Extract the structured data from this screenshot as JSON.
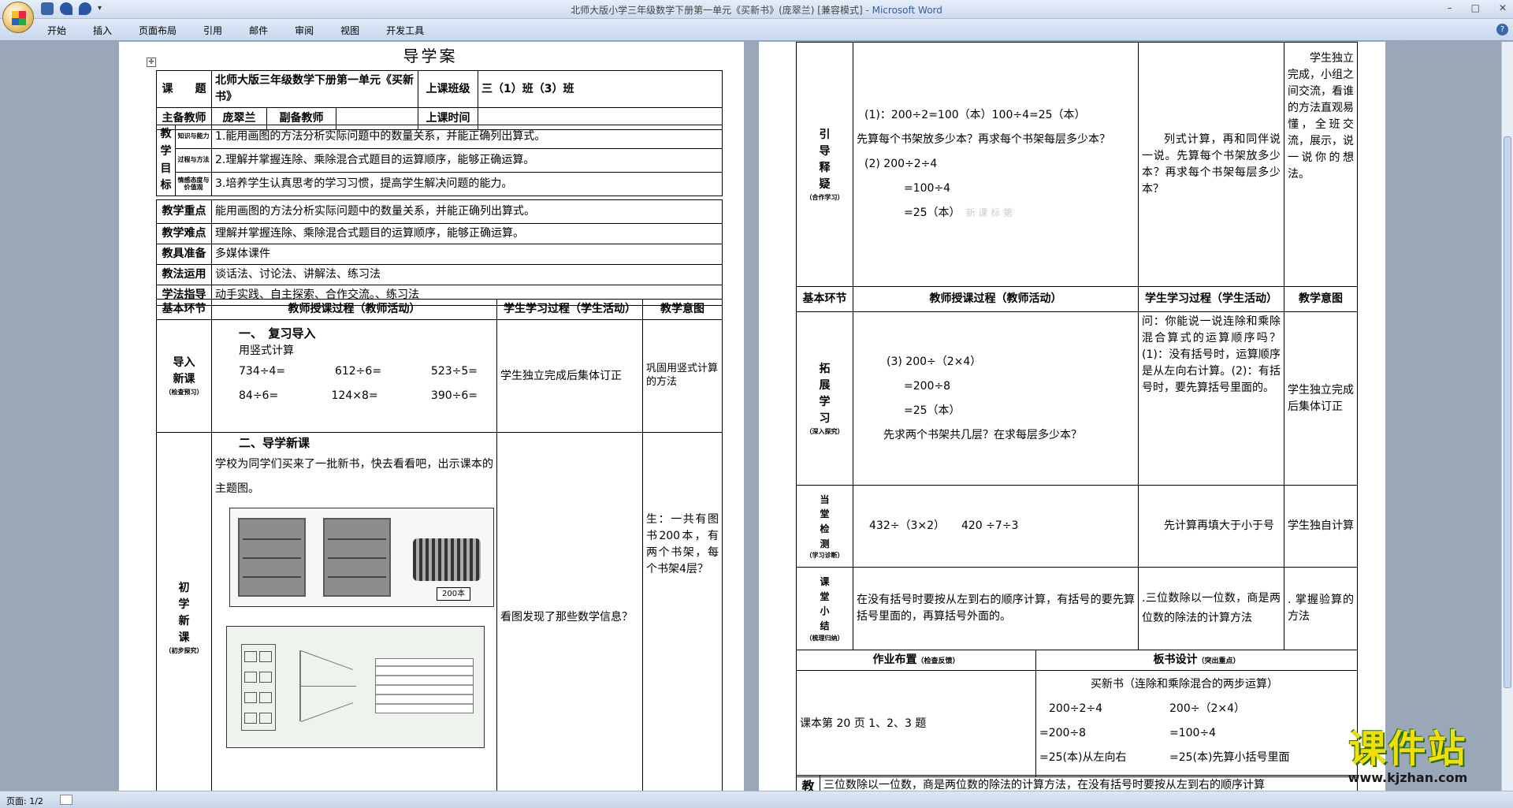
{
  "window": {
    "title": "北师大版小学三年级数学下册第一单元《买新书》(庞翠兰) [兼容模式]",
    "app_name": " - Microsoft Word"
  },
  "ribbon_tabs": [
    "开始",
    "插入",
    "页面布局",
    "引用",
    "邮件",
    "审阅",
    "视图",
    "开发工具"
  ],
  "status": {
    "page": "页面: 1/2"
  },
  "logo": {
    "text": "课件站",
    "url": "www.kjzhan.com"
  },
  "page1": {
    "title": "导学案",
    "labels": {
      "topic": "课　　题",
      "class": "上课班级",
      "lead_teacher": "主备教师",
      "co_teacher": "副备教师",
      "time": "上课时间",
      "goal": "教学目标",
      "g1": "知识与能力",
      "g2": "过程与方法",
      "g3": "情感态度与价值观",
      "key": "教学重点",
      "diff": "教学难点",
      "tools": "教具准备",
      "method": "教法运用",
      "study": "学法指导",
      "phase": "基本环节",
      "teach": "教师授课过程（教师活动）",
      "learn": "学生学习过程（学生活动）",
      "intent": "教学意图"
    },
    "topic": "北师大版三年级数学下册第一单元《买新书》",
    "class_name": "三（1）班（3）班",
    "lead_teacher": "庞翠兰",
    "goals": [
      "1.能用画图的方法分析实际问题中的数量关系，并能正确列出算式。",
      "2.理解并掌握连除、乘除混合式题目的运算顺序，能够正确运算。",
      "3.培养学生认真思考的学习习惯，提高学生解决问题的能力。"
    ],
    "key_point": "能用画图的方法分析实际问题中的数量关系，并能正确列出算式。",
    "difficulty": "理解并掌握连除、乘除混合式题目的运算顺序，能够正确运算。",
    "tools": "多媒体课件",
    "methods": "谈话法、讨论法、讲解法、练习法",
    "study": "动手实践、自主探索、合作交流。、练习法",
    "intro": {
      "phase": [
        "导",
        "入",
        "新",
        "课"
      ],
      "phase_sub": "（检查预习）",
      "heading": "一、　复习导入",
      "sub": "用竖式计算",
      "calcs": [
        [
          "734÷4=",
          "612÷6=",
          "523÷5="
        ],
        [
          "84÷6=",
          "124×8=",
          "390÷6="
        ]
      ],
      "learn": "学生独立完成后集体订正",
      "intent": "巩固用竖式计算的方法"
    },
    "new": {
      "phase": [
        "初",
        "学",
        "新",
        "课"
      ],
      "phase_sub": "（初步探究）",
      "heading": "二、导学新课",
      "text": "学校为同学们买来了一批新书，快去看看吧，出示课本的主题图。",
      "tag": "200本",
      "learn": "看图发现了那些数学信息？",
      "intent": "生：一共有图书200本，有两个书架，每个书架4层？"
    }
  },
  "page2": {
    "guide": {
      "phase": [
        "引",
        "导",
        "释",
        "疑"
      ],
      "phase_sub": "（合作学习）",
      "lines": [
        "(1)：200÷2=100（本）100÷4=25（本）",
        "先算每个书架放多少本？再求每个书架每层多少本？",
        "(2) 200÷2÷4",
        "=100÷4",
        "=25（本）"
      ],
      "watermark": "新 课 标 第",
      "learn": "列式计算，再和同伴说一说。先算每个书架放多少本？再求每个书架每层多少本？",
      "intent": "学生独立完成，小组之间交流，看谁的方法直观易懂，全班交流，展示，说一说你的想法。"
    },
    "header": {
      "phase": "基本环节",
      "teach": "教师授课过程（教师活动）",
      "learn": "学生学习过程（学生活动）",
      "intent": "教学意图"
    },
    "expand": {
      "phase": [
        "拓",
        "展",
        "学",
        "习"
      ],
      "phase_sub": "（深入探究）",
      "lines": [
        "(3) 200÷（2×4）",
        "=200÷8",
        "=25（本）",
        "先求两个书架共几层？在求每层多少本？"
      ],
      "learn": "问：你能说一说连除和乘除混合算式的运算顺序吗？(1)：没有括号时，运算顺序是从左向右计算。(2)：有括号时，要先算括号里面的。",
      "intent": "学生独立完成后集体订正"
    },
    "check": {
      "phase": [
        "当",
        "堂",
        "检",
        "测"
      ],
      "phase_sub": "（学习诊断）",
      "text": "432÷（3×2）　　420 ÷7÷3",
      "learn": "先计算再填大于小于号",
      "intent": "学生独自计算"
    },
    "summary": {
      "phase": [
        "课",
        "堂",
        "小",
        "结"
      ],
      "phase_sub": "（梳理归纳）",
      "text": "在没有括号时要按从左到右的顺序计算，有括号的要先算括号里面的，再算括号外面的。",
      "learn": ".三位数除以一位数，商是两位数的除法的计算方法",
      "intent": ". 掌握验算的方法"
    },
    "homework": {
      "title": "作业布置",
      "title_sub": "（检查反馈）",
      "text": "课本第 20 页 1、2、3 题"
    },
    "board": {
      "title": "板书设计",
      "title_sub": "（突出重点）",
      "heading": "买新书（连除和乘除混合的两步运算）",
      "left": [
        "200÷2÷4",
        "=200÷8",
        "=25(本)从左向右"
      ],
      "right": [
        "200÷（2×4）",
        "=100÷4",
        "=25(本)先算小括号里面"
      ]
    },
    "reflect": {
      "label": "教",
      "text": "三位数除以一位数，商是两位数的除法的计算方法，在没有括号时要按从左到右的顺序计算"
    }
  }
}
